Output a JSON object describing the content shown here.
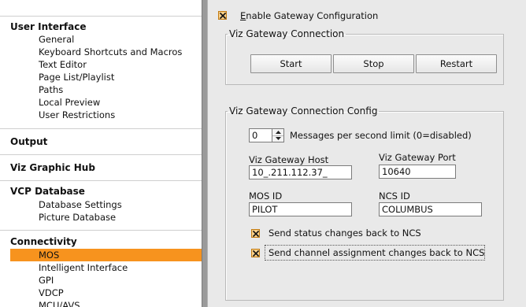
{
  "sidebar": {
    "groups": [
      {
        "title": "User Interface",
        "items": [
          "General",
          "Keyboard Shortcuts and Macros",
          "Text Editor",
          "Page List/Playlist",
          "Paths",
          "Local Preview",
          "User Restrictions"
        ]
      },
      {
        "title": "Output",
        "items": []
      },
      {
        "title": "Viz Graphic Hub",
        "items": []
      },
      {
        "title": "VCP Database",
        "items": [
          "Database Settings",
          "Picture Database"
        ]
      },
      {
        "title": "Connectivity",
        "items": [
          "MOS",
          "Intelligent Interface",
          "GPI",
          "VDCP",
          "MCU/AVS"
        ]
      }
    ],
    "selected_item": "MOS",
    "selected_color": "#f7931e"
  },
  "settings": {
    "enable_gateway": {
      "label_accel": "E",
      "label_rest": "nable Gateway Configuration",
      "checked": true
    },
    "connection_group": {
      "legend": "Viz Gateway Connection",
      "start_label": "Start",
      "stop_label": "Stop",
      "restart_label": "Restart"
    },
    "config_group": {
      "legend": "Viz Gateway Connection Config",
      "messages_limit": {
        "value": "0",
        "label": "Messages per second limit (0=disabled)"
      },
      "host": {
        "label": "Viz Gateway Host",
        "value": "10_.211.112.37_"
      },
      "port": {
        "label": "Viz Gateway Port",
        "value": "10640"
      },
      "mos_id": {
        "label": "MOS ID",
        "value": "PILOT"
      },
      "ncs_id": {
        "label": "NCS ID",
        "value": "COLUMBUS"
      },
      "send_status": {
        "label": "Send status changes back to NCS",
        "checked": true
      },
      "send_channel": {
        "label": "Send channel assignment changes back to NCS",
        "checked": true
      }
    }
  },
  "icons": {
    "check": "check-mark-icon",
    "spin_up": "arrow-up-icon",
    "spin_down": "arrow-down-icon"
  }
}
